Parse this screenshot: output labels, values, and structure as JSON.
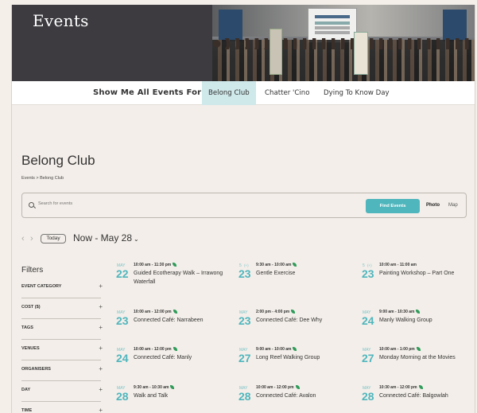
{
  "hero": {
    "title": "Events"
  },
  "filterbar": {
    "label": "Show Me All Events For:",
    "tabs": [
      "Belong Club",
      "Chatter 'Cino",
      "Dying To Know Day"
    ]
  },
  "page": {
    "title": "Belong Club",
    "breadcrumb": "Events > Belong Club"
  },
  "search": {
    "placeholder": "Search for events",
    "button": "Find Events",
    "view_photo": "Photo",
    "view_map": "Map"
  },
  "nav": {
    "today": "Today",
    "range": "Now - May 28",
    "caret": "⌄",
    "prev": "‹",
    "next": "›"
  },
  "filters": {
    "title": "Filters",
    "items": [
      "EVENT CATEGORY",
      "COST ($)",
      "TAGS",
      "VENUES",
      "ORGANISERS",
      "DAY",
      "TIME"
    ],
    "plus": "+"
  },
  "events": [
    {
      "month": "MAY",
      "day": "22",
      "time": "10:00 am - 11:30 pm",
      "title": "Guided Ecotherapy Walk – Irrawong Waterfall"
    },
    {
      "month": "5",
      "badge": "(+)",
      "day": "23",
      "time": "9:30 am - 10:00 am",
      "title": "Gentle Exercise"
    },
    {
      "month": "5",
      "badge": "(+)",
      "day": "23",
      "time": "10:00 am - 11:00 am",
      "title": "Painting Workshop – Part One"
    },
    {
      "month": "MAY",
      "day": "23",
      "time": "10:00 am - 12:00 pm",
      "title": "Connected Café: Narrabeen"
    },
    {
      "month": "MAY",
      "day": "23",
      "time": "2:00 pm - 4:00 pm",
      "title": "Connected Café: Dee Why"
    },
    {
      "month": "MAY",
      "day": "24",
      "time": "9:00 am - 10:30 am",
      "title": "Manly Walking Group"
    },
    {
      "month": "MAY",
      "day": "24",
      "time": "10:00 am - 12:00 pm",
      "title": "Connected Café: Manly"
    },
    {
      "month": "MAY",
      "day": "27",
      "time": "9:00 am - 10:00 am",
      "title": "Long Reef Walking Group"
    },
    {
      "month": "MAY",
      "day": "27",
      "time": "10:00 am - 1:00 pm",
      "title": "Monday Morning at the Movies"
    },
    {
      "month": "MAY",
      "day": "28",
      "time": "9:30 am - 10:30 am",
      "title": "Walk and Talk"
    },
    {
      "month": "MAY",
      "day": "28",
      "time": "10:00 am - 12:00 pm",
      "title": "Connected Café: Avalon"
    },
    {
      "month": "MAY",
      "day": "28",
      "time": "10:30 am - 12:00 pm",
      "title": "Connected Café: Balgowlah"
    }
  ]
}
